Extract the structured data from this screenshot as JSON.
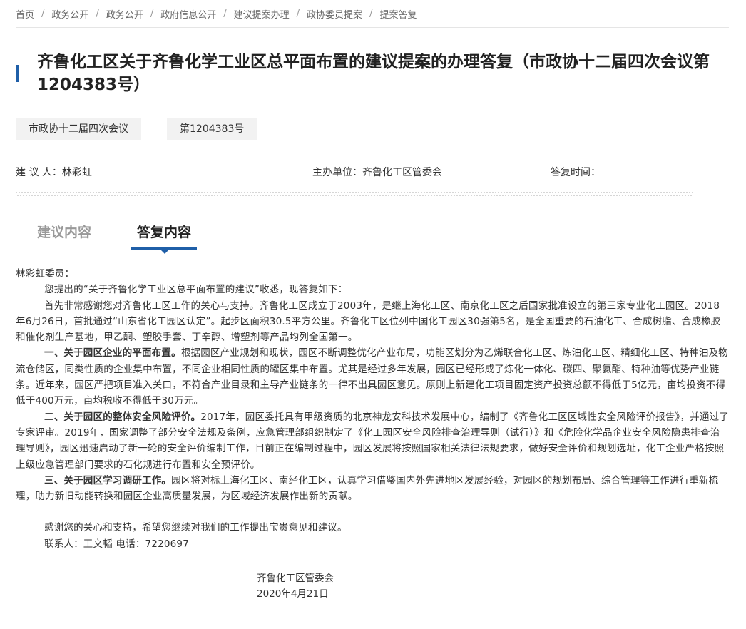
{
  "breadcrumb": [
    "首页",
    "政务公开",
    "政务公开",
    "政府信息公开",
    "建议提案办理",
    "政协委员提案",
    "提案答复"
  ],
  "title": "齐鲁化工区关于齐鲁化学工业区总平面布置的建议提案的办理答复（市政协十二届四次会议第1204383号）",
  "tags": [
    "市政协十二届四次会议",
    "第1204383号"
  ],
  "meta": {
    "proposer": "建 议 人：林彩虹",
    "host_unit": "主办单位：齐鲁化工区管委会",
    "reply_time": "答复时间："
  },
  "tabs": {
    "proposal": "建议内容",
    "reply": "答复内容"
  },
  "letter": {
    "salutation": "林彩虹委员：",
    "intro": "您提出的“关于齐鲁化学工业区总平面布置的建议”收悉，现答复如下：",
    "para1": "首先非常感谢您对齐鲁化工区工作的关心与支持。齐鲁化工区成立于2003年，是继上海化工区、南京化工区之后国家批准设立的第三家专业化工园区。2018年6月26日，首批通过“山东省化工园区认定”。起步区面积30.5平方公里。齐鲁化工区位列中国化工园区30强第5名，是全国重要的石油化工、合成树脂、合成橡胶和催化剂生产基地，甲乙酮、塑胶手套、丁辛醇、增塑剂等产品均列全国第一。",
    "p2_head": "一、关于园区企业的平面布置。",
    "p2_body": "根据园区产业规划和现状，园区不断调整优化产业布局，功能区划分为乙烯联合化工区、炼油化工区、精细化工区、特种油及物流仓储区，同类性质的企业集中布置，不同企业相同性质的罐区集中布置。尤其是经过多年发展，园区已经形成了炼化一体化、碳四、聚氨酯、特种油等优势产业链条。近年来，园区严把项目准入关口，不符合产业目录和主导产业链条的一律不出具园区意见。原则上新建化工项目固定资产投资总额不得低于5亿元，亩均投资不得低于400万元，亩均税收不得低于30万元。",
    "p3_head": "二、关于园区的整体安全风险评价。",
    "p3_body": "2017年，园区委托具有甲级资质的北京神龙安科技术发展中心，编制了《齐鲁化工区区域性安全风险评价报告》，并通过了专家评审。2019年，国家调整了部分安全法规及条例，应急管理部组织制定了《化工园区安全风险排查治理导则（试行）》和《危险化学品企业安全风险隐患排查治理导则》，园区迅速启动了新一轮的安全评价编制工作，目前正在编制过程中，园区发展将按照国家相关法律法规要求，做好安全评价和规划选址，化工企业严格按照上级应急管理部门要求的石化规进行布置和安全预评价。",
    "p4_head": "三、关于园区学习调研工作。",
    "p4_body": "园区将对标上海化工区、南经化工区，认真学习借鉴国内外先进地区发展经验，对园区的规划布局、综合管理等工作进行重新梳理，助力新旧动能转换和园区企业高质量发展，为区域经济发展作出新的贡献。",
    "thanks": "感谢您的关心和支持，希望您继续对我们的工作提出宝贵意见和建议。",
    "contact": "联系人：王文韬 电话：7220697",
    "signature": "齐鲁化工区管委会",
    "date": "2020年4月21日"
  },
  "colors": {
    "accent": "#1f5fa8",
    "tag_bg": "#f2f2f2",
    "inactive_tab": "#999999"
  }
}
